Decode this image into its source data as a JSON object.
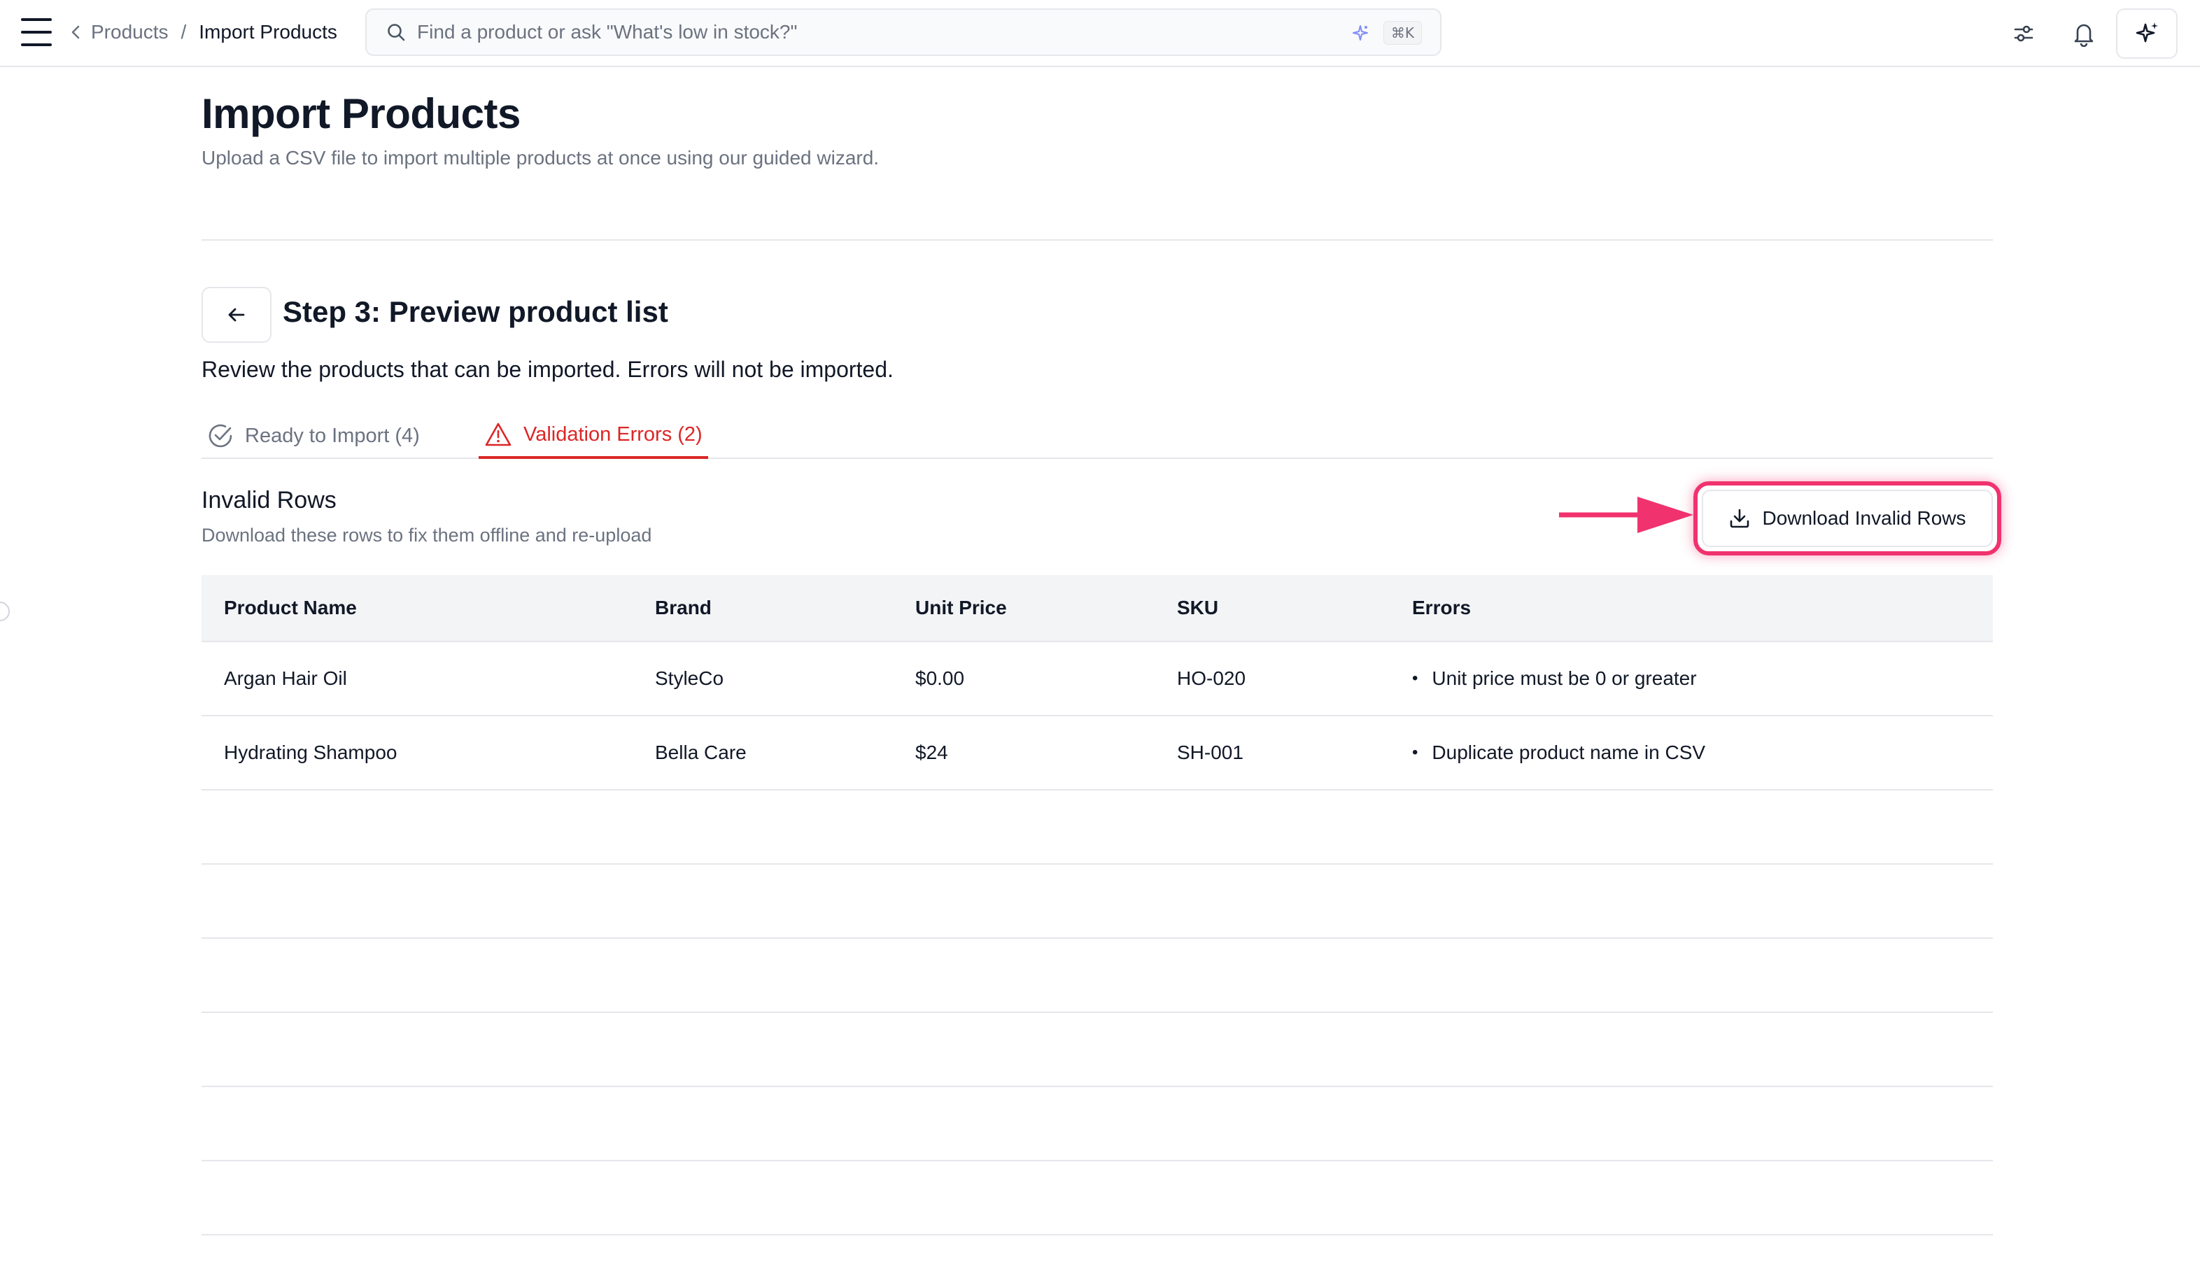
{
  "header": {
    "breadcrumb_parent": "Products",
    "breadcrumb_separator": "/",
    "breadcrumb_current": "Import Products",
    "search_placeholder": "Find a product or ask \"What's low in stock?\"",
    "search_shortcut": "⌘K"
  },
  "page": {
    "title": "Import Products",
    "subtitle": "Upload a CSV file to import multiple products at once using our guided wizard."
  },
  "step": {
    "title": "Step 3: Preview product list",
    "description": "Review the products that can be imported. Errors will not be imported."
  },
  "tabs": [
    {
      "label": "Ready to Import (4)",
      "active": false
    },
    {
      "label": "Validation Errors (2)",
      "active": true
    }
  ],
  "section": {
    "title": "Invalid Rows",
    "subtitle": "Download these rows to fix them offline and re-upload",
    "download_label": "Download Invalid Rows"
  },
  "table": {
    "headers": [
      "Product Name",
      "Brand",
      "Unit Price",
      "SKU",
      "Errors"
    ],
    "rows": [
      {
        "name": "Argan Hair Oil",
        "brand": "StyleCo",
        "price": "$0.00",
        "sku": "HO-020",
        "error": "Unit price must be 0 or greater"
      },
      {
        "name": "Hydrating Shampoo",
        "brand": "Bella Care",
        "price": "$24",
        "sku": "SH-001",
        "error": "Duplicate product name in CSV"
      }
    ]
  },
  "colors": {
    "error": "#dc2626",
    "highlight": "#f0326e",
    "muted_text": "#6b7280"
  }
}
